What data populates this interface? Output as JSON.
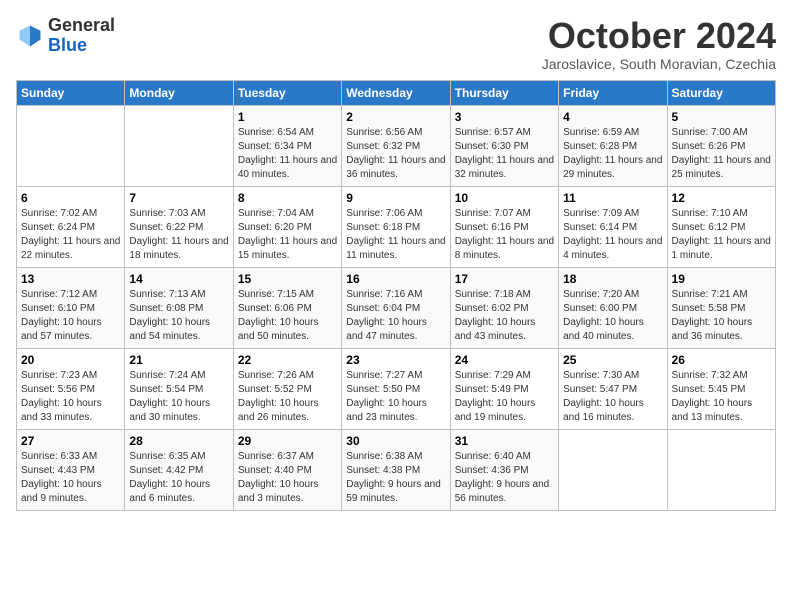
{
  "logo": {
    "general": "General",
    "blue": "Blue"
  },
  "title": "October 2024",
  "subtitle": "Jaroslavice, South Moravian, Czechia",
  "days_header": [
    "Sunday",
    "Monday",
    "Tuesday",
    "Wednesday",
    "Thursday",
    "Friday",
    "Saturday"
  ],
  "weeks": [
    [
      {
        "day": "",
        "info": ""
      },
      {
        "day": "",
        "info": ""
      },
      {
        "day": "1",
        "info": "Sunrise: 6:54 AM\nSunset: 6:34 PM\nDaylight: 11 hours and 40 minutes."
      },
      {
        "day": "2",
        "info": "Sunrise: 6:56 AM\nSunset: 6:32 PM\nDaylight: 11 hours and 36 minutes."
      },
      {
        "day": "3",
        "info": "Sunrise: 6:57 AM\nSunset: 6:30 PM\nDaylight: 11 hours and 32 minutes."
      },
      {
        "day": "4",
        "info": "Sunrise: 6:59 AM\nSunset: 6:28 PM\nDaylight: 11 hours and 29 minutes."
      },
      {
        "day": "5",
        "info": "Sunrise: 7:00 AM\nSunset: 6:26 PM\nDaylight: 11 hours and 25 minutes."
      }
    ],
    [
      {
        "day": "6",
        "info": "Sunrise: 7:02 AM\nSunset: 6:24 PM\nDaylight: 11 hours and 22 minutes."
      },
      {
        "day": "7",
        "info": "Sunrise: 7:03 AM\nSunset: 6:22 PM\nDaylight: 11 hours and 18 minutes."
      },
      {
        "day": "8",
        "info": "Sunrise: 7:04 AM\nSunset: 6:20 PM\nDaylight: 11 hours and 15 minutes."
      },
      {
        "day": "9",
        "info": "Sunrise: 7:06 AM\nSunset: 6:18 PM\nDaylight: 11 hours and 11 minutes."
      },
      {
        "day": "10",
        "info": "Sunrise: 7:07 AM\nSunset: 6:16 PM\nDaylight: 11 hours and 8 minutes."
      },
      {
        "day": "11",
        "info": "Sunrise: 7:09 AM\nSunset: 6:14 PM\nDaylight: 11 hours and 4 minutes."
      },
      {
        "day": "12",
        "info": "Sunrise: 7:10 AM\nSunset: 6:12 PM\nDaylight: 11 hours and 1 minute."
      }
    ],
    [
      {
        "day": "13",
        "info": "Sunrise: 7:12 AM\nSunset: 6:10 PM\nDaylight: 10 hours and 57 minutes."
      },
      {
        "day": "14",
        "info": "Sunrise: 7:13 AM\nSunset: 6:08 PM\nDaylight: 10 hours and 54 minutes."
      },
      {
        "day": "15",
        "info": "Sunrise: 7:15 AM\nSunset: 6:06 PM\nDaylight: 10 hours and 50 minutes."
      },
      {
        "day": "16",
        "info": "Sunrise: 7:16 AM\nSunset: 6:04 PM\nDaylight: 10 hours and 47 minutes."
      },
      {
        "day": "17",
        "info": "Sunrise: 7:18 AM\nSunset: 6:02 PM\nDaylight: 10 hours and 43 minutes."
      },
      {
        "day": "18",
        "info": "Sunrise: 7:20 AM\nSunset: 6:00 PM\nDaylight: 10 hours and 40 minutes."
      },
      {
        "day": "19",
        "info": "Sunrise: 7:21 AM\nSunset: 5:58 PM\nDaylight: 10 hours and 36 minutes."
      }
    ],
    [
      {
        "day": "20",
        "info": "Sunrise: 7:23 AM\nSunset: 5:56 PM\nDaylight: 10 hours and 33 minutes."
      },
      {
        "day": "21",
        "info": "Sunrise: 7:24 AM\nSunset: 5:54 PM\nDaylight: 10 hours and 30 minutes."
      },
      {
        "day": "22",
        "info": "Sunrise: 7:26 AM\nSunset: 5:52 PM\nDaylight: 10 hours and 26 minutes."
      },
      {
        "day": "23",
        "info": "Sunrise: 7:27 AM\nSunset: 5:50 PM\nDaylight: 10 hours and 23 minutes."
      },
      {
        "day": "24",
        "info": "Sunrise: 7:29 AM\nSunset: 5:49 PM\nDaylight: 10 hours and 19 minutes."
      },
      {
        "day": "25",
        "info": "Sunrise: 7:30 AM\nSunset: 5:47 PM\nDaylight: 10 hours and 16 minutes."
      },
      {
        "day": "26",
        "info": "Sunrise: 7:32 AM\nSunset: 5:45 PM\nDaylight: 10 hours and 13 minutes."
      }
    ],
    [
      {
        "day": "27",
        "info": "Sunrise: 6:33 AM\nSunset: 4:43 PM\nDaylight: 10 hours and 9 minutes."
      },
      {
        "day": "28",
        "info": "Sunrise: 6:35 AM\nSunset: 4:42 PM\nDaylight: 10 hours and 6 minutes."
      },
      {
        "day": "29",
        "info": "Sunrise: 6:37 AM\nSunset: 4:40 PM\nDaylight: 10 hours and 3 minutes."
      },
      {
        "day": "30",
        "info": "Sunrise: 6:38 AM\nSunset: 4:38 PM\nDaylight: 9 hours and 59 minutes."
      },
      {
        "day": "31",
        "info": "Sunrise: 6:40 AM\nSunset: 4:36 PM\nDaylight: 9 hours and 56 minutes."
      },
      {
        "day": "",
        "info": ""
      },
      {
        "day": "",
        "info": ""
      }
    ]
  ]
}
